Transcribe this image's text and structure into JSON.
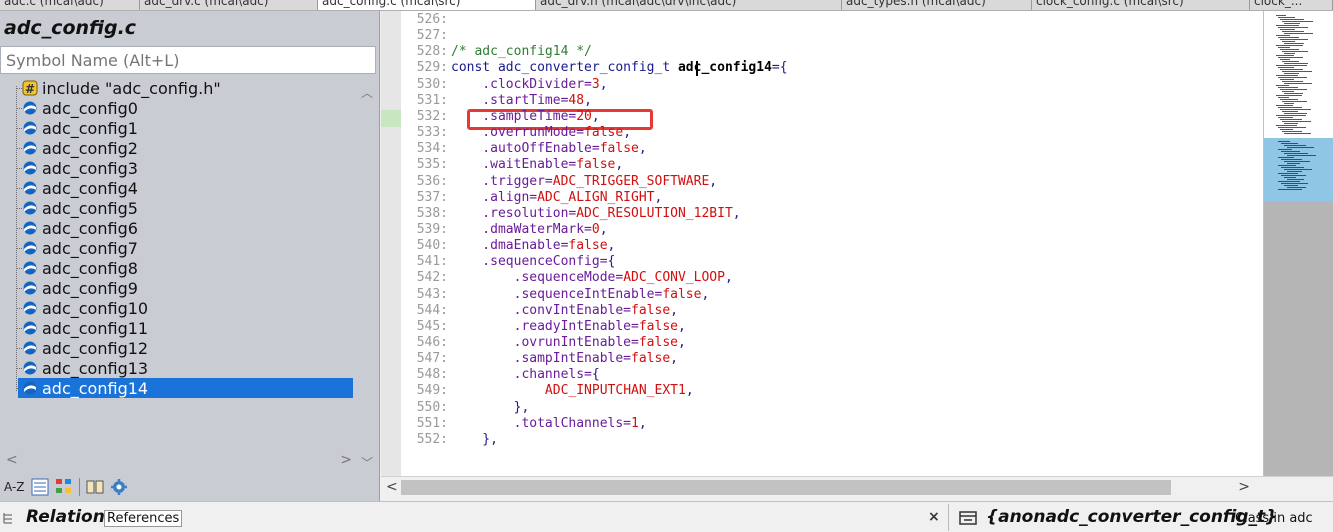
{
  "tabs": [
    {
      "label": "adc.c (mcal\\adc)",
      "active": false
    },
    {
      "label": "adc_drv.c (mcal\\adc)",
      "active": false
    },
    {
      "label": "adc_config.c (mcal\\src)",
      "active": true
    },
    {
      "label": "adc_drv.h (mcal\\adc\\drv\\inc\\adc)",
      "active": false
    },
    {
      "label": "adc_types.h (mcal\\adc)",
      "active": false
    },
    {
      "label": "clock_config.c (mcal\\src)",
      "active": false
    },
    {
      "label": "clock_...",
      "active": false
    }
  ],
  "symbol_panel": {
    "file_title": "adc_config.c",
    "search_placeholder": "Symbol Name (Alt+L)",
    "items": [
      {
        "label": "include \"adc_config.h\"",
        "icon": "include-icon"
      },
      {
        "label": "adc_config0",
        "icon": "variable-icon"
      },
      {
        "label": "adc_config1",
        "icon": "variable-icon"
      },
      {
        "label": "adc_config2",
        "icon": "variable-icon"
      },
      {
        "label": "adc_config3",
        "icon": "variable-icon"
      },
      {
        "label": "adc_config4",
        "icon": "variable-icon"
      },
      {
        "label": "adc_config5",
        "icon": "variable-icon"
      },
      {
        "label": "adc_config6",
        "icon": "variable-icon"
      },
      {
        "label": "adc_config7",
        "icon": "variable-icon"
      },
      {
        "label": "adc_config8",
        "icon": "variable-icon"
      },
      {
        "label": "adc_config9",
        "icon": "variable-icon"
      },
      {
        "label": "adc_config10",
        "icon": "variable-icon"
      },
      {
        "label": "adc_config11",
        "icon": "variable-icon"
      },
      {
        "label": "adc_config12",
        "icon": "variable-icon"
      },
      {
        "label": "adc_config13",
        "icon": "variable-icon"
      },
      {
        "label": "adc_config14",
        "icon": "variable-icon",
        "selected": true
      }
    ],
    "toolbar": {
      "sort_label": "A-Z"
    }
  },
  "editor": {
    "lines": [
      {
        "num": "526:",
        "tokens": []
      },
      {
        "num": "527:",
        "tokens": []
      },
      {
        "num": "528:",
        "tokens": [
          {
            "t": "/* adc_config14 */",
            "c": "com"
          }
        ]
      },
      {
        "num": "529:",
        "tokens": [
          {
            "t": "const adc_converter_config_t ",
            "c": "kw"
          },
          {
            "t": "adc_config14",
            "c": "bold"
          },
          {
            "t": "={",
            "c": "plain"
          }
        ]
      },
      {
        "num": "530:",
        "tokens": [
          {
            "t": "    .clockDivider=",
            "c": "mem"
          },
          {
            "t": "3",
            "c": "red"
          },
          {
            "t": ",",
            "c": "plain"
          }
        ]
      },
      {
        "num": "531:",
        "tokens": [
          {
            "t": "    .startTime=",
            "c": "mem"
          },
          {
            "t": "48",
            "c": "red"
          },
          {
            "t": ",",
            "c": "plain"
          }
        ]
      },
      {
        "num": "532:",
        "tokens": [
          {
            "t": "    .sampleTime=",
            "c": "mem"
          },
          {
            "t": "20",
            "c": "red"
          },
          {
            "t": ",",
            "c": "plain"
          }
        ]
      },
      {
        "num": "533:",
        "tokens": [
          {
            "t": "    .overrunMode=",
            "c": "mem"
          },
          {
            "t": "false",
            "c": "red"
          },
          {
            "t": ",",
            "c": "plain"
          }
        ]
      },
      {
        "num": "534:",
        "tokens": [
          {
            "t": "    .autoOffEnable=",
            "c": "mem"
          },
          {
            "t": "false",
            "c": "red"
          },
          {
            "t": ",",
            "c": "plain"
          }
        ]
      },
      {
        "num": "535:",
        "tokens": [
          {
            "t": "    .waitEnable=",
            "c": "mem"
          },
          {
            "t": "false",
            "c": "red"
          },
          {
            "t": ",",
            "c": "plain"
          }
        ]
      },
      {
        "num": "536:",
        "tokens": [
          {
            "t": "    .trigger=",
            "c": "mem"
          },
          {
            "t": "ADC_TRIGGER_SOFTWARE",
            "c": "red"
          },
          {
            "t": ",",
            "c": "plain"
          }
        ]
      },
      {
        "num": "537:",
        "tokens": [
          {
            "t": "    .align=",
            "c": "mem"
          },
          {
            "t": "ADC_ALIGN_RIGHT",
            "c": "red"
          },
          {
            "t": ",",
            "c": "plain"
          }
        ]
      },
      {
        "num": "538:",
        "tokens": [
          {
            "t": "    .resolution=",
            "c": "mem"
          },
          {
            "t": "ADC_RESOLUTION_12BIT",
            "c": "red"
          },
          {
            "t": ",",
            "c": "plain"
          }
        ]
      },
      {
        "num": "539:",
        "tokens": [
          {
            "t": "    .dmaWaterMark=",
            "c": "mem"
          },
          {
            "t": "0",
            "c": "red"
          },
          {
            "t": ",",
            "c": "plain"
          }
        ]
      },
      {
        "num": "540:",
        "tokens": [
          {
            "t": "    .dmaEnable=",
            "c": "mem"
          },
          {
            "t": "false",
            "c": "red"
          },
          {
            "t": ",",
            "c": "plain"
          }
        ]
      },
      {
        "num": "541:",
        "tokens": [
          {
            "t": "    .sequenceConfig=",
            "c": "mem"
          },
          {
            "t": "{",
            "c": "plain"
          }
        ]
      },
      {
        "num": "542:",
        "tokens": [
          {
            "t": "        .sequenceMode=",
            "c": "mem"
          },
          {
            "t": "ADC_CONV_LOOP",
            "c": "red"
          },
          {
            "t": ",",
            "c": "plain"
          }
        ]
      },
      {
        "num": "543:",
        "tokens": [
          {
            "t": "        .sequenceIntEnable=",
            "c": "mem"
          },
          {
            "t": "false",
            "c": "red"
          },
          {
            "t": ",",
            "c": "plain"
          }
        ]
      },
      {
        "num": "544:",
        "tokens": [
          {
            "t": "        .convIntEnable=",
            "c": "mem"
          },
          {
            "t": "false",
            "c": "red"
          },
          {
            "t": ",",
            "c": "plain"
          }
        ]
      },
      {
        "num": "545:",
        "tokens": [
          {
            "t": "        .readyIntEnable=",
            "c": "mem"
          },
          {
            "t": "false",
            "c": "red"
          },
          {
            "t": ",",
            "c": "plain"
          }
        ]
      },
      {
        "num": "546:",
        "tokens": [
          {
            "t": "        .ovrunIntEnable=",
            "c": "mem"
          },
          {
            "t": "false",
            "c": "red"
          },
          {
            "t": ",",
            "c": "plain"
          }
        ]
      },
      {
        "num": "547:",
        "tokens": [
          {
            "t": "        .sampIntEnable=",
            "c": "mem"
          },
          {
            "t": "false",
            "c": "red"
          },
          {
            "t": ",",
            "c": "plain"
          }
        ]
      },
      {
        "num": "548:",
        "tokens": [
          {
            "t": "        .channels=",
            "c": "mem"
          },
          {
            "t": "{",
            "c": "plain"
          }
        ]
      },
      {
        "num": "549:",
        "tokens": [
          {
            "t": "            ",
            "c": "plain"
          },
          {
            "t": "ADC_INPUTCHAN_EXT1",
            "c": "red"
          },
          {
            "t": ",",
            "c": "plain"
          }
        ]
      },
      {
        "num": "550:",
        "tokens": [
          {
            "t": "        },",
            "c": "plain"
          }
        ]
      },
      {
        "num": "551:",
        "tokens": [
          {
            "t": "        .totalChannels=",
            "c": "mem"
          },
          {
            "t": "1",
            "c": "red"
          },
          {
            "t": ",",
            "c": "plain"
          }
        ]
      },
      {
        "num": "552:",
        "tokens": [
          {
            "t": "    },",
            "c": "plain"
          }
        ]
      }
    ]
  },
  "relation_panel": {
    "title": "Relation",
    "tab": "References",
    "close": "×"
  },
  "class_panel": {
    "name": "{anonadc_converter_config_t}",
    "kind": "Class in adc"
  },
  "colors": {
    "selection": "#1a73d9",
    "highlight_box": "#e53935",
    "minimap_highlight": "#8fc6e6"
  }
}
